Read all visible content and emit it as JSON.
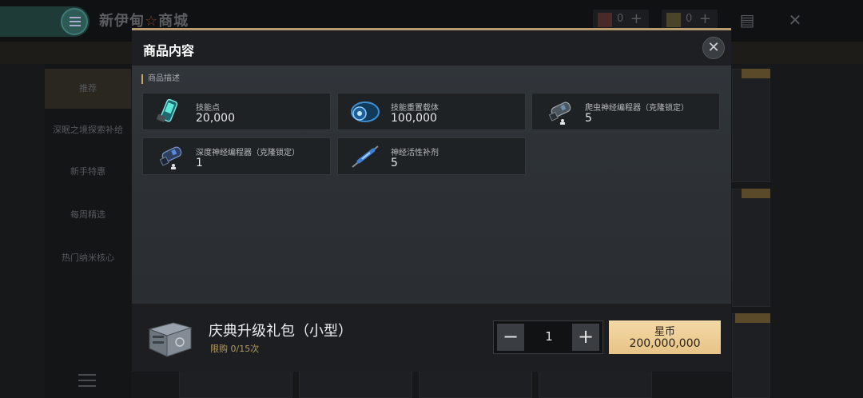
{
  "background": {
    "shop_title_left": "新伊甸",
    "shop_title_star": "☆",
    "shop_title_right": "商城",
    "currencies": [
      {
        "icon": "a-currency-icon",
        "value": "0",
        "plus": "+"
      },
      {
        "icon": "x-currency-icon",
        "value": "0",
        "plus": "+"
      }
    ],
    "sidebar": [
      "推荐",
      "深眠之境探索补给",
      "新手特惠",
      "每周精选",
      "热门纳米核心"
    ]
  },
  "modal": {
    "title": "商品内容",
    "close": "✕",
    "section_label": "商品描述",
    "items": [
      {
        "name": "技能点",
        "qty": "20,000",
        "icon": "skill-point-capsule-icon"
      },
      {
        "name": "技能重置载体",
        "qty": "100,000",
        "icon": "skill-reset-carrier-icon"
      },
      {
        "name": "爬虫神经编程器（克隆锁定）",
        "qty": "5",
        "icon": "crawler-neural-programmer-icon"
      },
      {
        "name": "深度神经编程器（克隆锁定）",
        "qty": "1",
        "icon": "deep-neural-programmer-icon"
      },
      {
        "name": "神经活性补剂",
        "qty": "5",
        "icon": "neural-activity-injector-icon"
      }
    ],
    "footer": {
      "package_name": "庆典升级礼包（小型）",
      "limit": "限购 0/15次",
      "minus": "−",
      "plus": "+",
      "quantity": "1",
      "currency": "星币",
      "price": "200,000,000"
    }
  },
  "colors": {
    "accent_gold": "#e7c488",
    "limit_text": "#b49b63",
    "modal_border": "#b79a6e"
  }
}
